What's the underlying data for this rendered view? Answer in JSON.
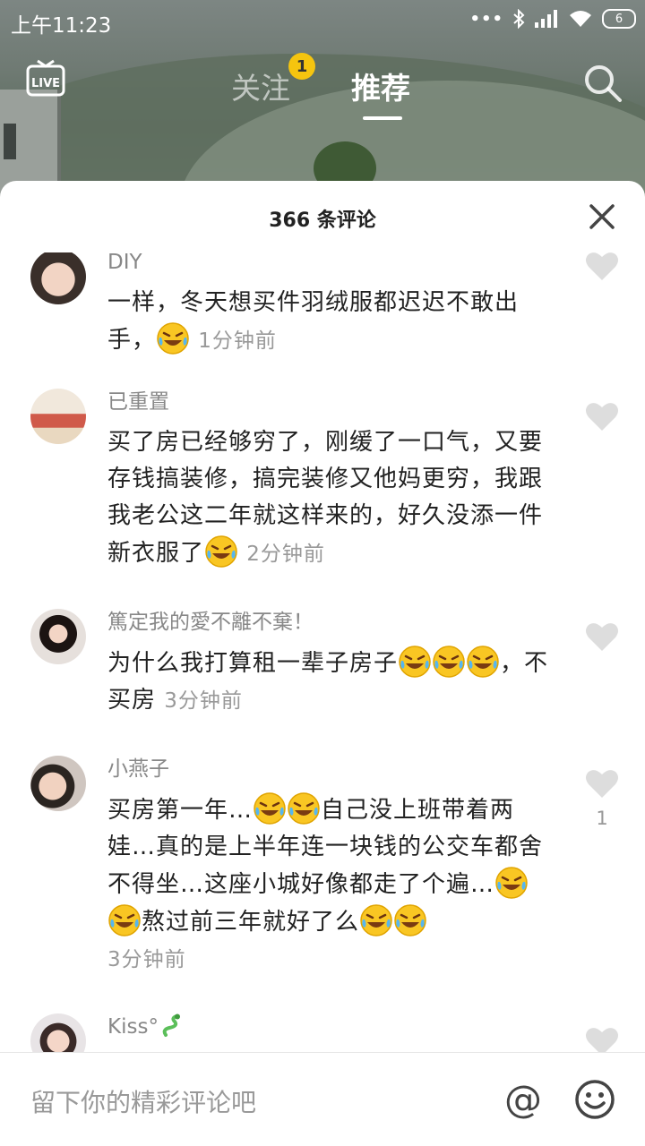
{
  "status_bar": {
    "time": "上午11:23",
    "battery": "6"
  },
  "top_nav": {
    "live_label": "LIVE",
    "tabs": [
      {
        "label": "关注",
        "badge": "1"
      },
      {
        "label": "推荐"
      }
    ],
    "active_tab": "推荐"
  },
  "comments_sheet": {
    "title": "366 条评论",
    "comments": [
      {
        "username": "DIY",
        "text": "一样，冬天想买件羽绒服都迟迟不敢出手，",
        "emojis": [
          "laughing-crying-emoji"
        ],
        "time": "1分钟前",
        "likes": ""
      },
      {
        "username": "已重置",
        "text": "买了房已经够穷了，刚缓了一口气，又要存钱搞装修，搞完装修又他妈更穷，我跟我老公这二年就这样来的，好久没添一件新衣服了",
        "emojis": [
          "laughing-crying-emoji"
        ],
        "time": "2分钟前",
        "likes": ""
      },
      {
        "username": "篤定我的愛不離不棄！",
        "text_a": "为什么我打算租一辈子房子",
        "text_b": "，不买房",
        "emojis": [
          "laughing-crying-emoji",
          "laughing-crying-emoji",
          "laughing-crying-emoji"
        ],
        "time": "3分钟前",
        "likes": ""
      },
      {
        "username": "小燕子",
        "text_a": "买房第一年…",
        "text_b": "自己没上班带着两娃…真的是上半年连一块钱的公交车都舍不得坐…这座小城好像都走了个遍…",
        "text_c": "熬过前三年就好了么",
        "time": "3分钟前",
        "likes": "1"
      },
      {
        "username": "Kiss°",
        "emojis": [
          "snake-emoji"
        ],
        "time": "",
        "likes": ""
      }
    ]
  },
  "input_bar": {
    "placeholder": "留下你的精彩评论吧",
    "at_symbol": "@"
  }
}
